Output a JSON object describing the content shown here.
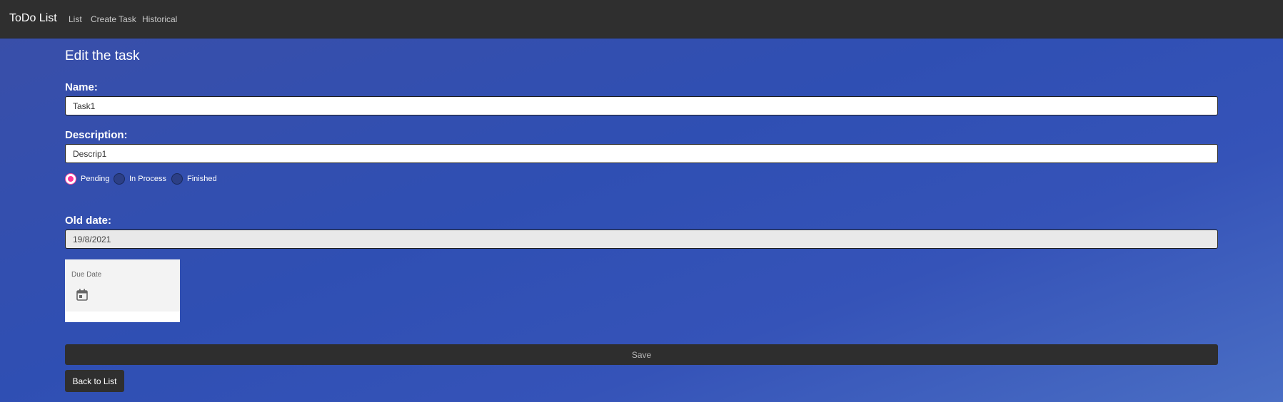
{
  "navbar": {
    "brand": "ToDo List",
    "links": [
      "List",
      "Create Task",
      "Historical"
    ]
  },
  "form": {
    "heading": "Edit the task",
    "name_label": "Name:",
    "name_value": "Task1",
    "description_label": "Description:",
    "description_value": "Descrip1",
    "status_options": [
      "Pending",
      "In Process",
      "Finished"
    ],
    "status_selected": "Pending",
    "old_date_label": "Old date:",
    "old_date_value": "19/8/2021",
    "due_date_label": "Due Date",
    "due_date_icon": "calendar-icon",
    "save_label": "Save",
    "back_label": "Back to List"
  },
  "colors": {
    "navbar": "#2f2f2f",
    "background": "#3553b8",
    "radio_accent": "#ff3399",
    "button": "#2e2e2e"
  }
}
